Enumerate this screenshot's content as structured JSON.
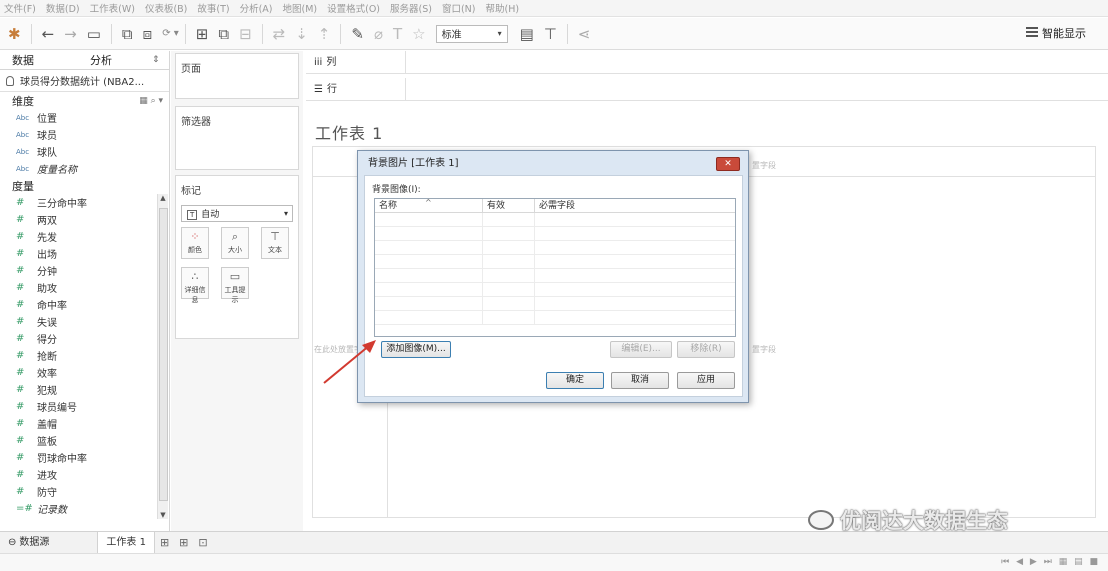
{
  "menu": [
    "文件(F)",
    "数据(D)",
    "工作表(W)",
    "仪表板(B)",
    "故事(T)",
    "分析(A)",
    "地图(M)",
    "设置格式(O)",
    "服务器(S)",
    "窗口(N)",
    "帮助(H)"
  ],
  "toolbar": {
    "fit_select": "标准",
    "smart_show": "智能显示"
  },
  "left_tabs": {
    "data": "数据",
    "analysis": "分析"
  },
  "datasource_name": "球员得分数据统计 (NBA2...",
  "dimensions": {
    "header": "维度",
    "items": [
      {
        "type": "Abc",
        "label": "位置"
      },
      {
        "type": "Abc",
        "label": "球员"
      },
      {
        "type": "Abc",
        "label": "球队"
      },
      {
        "type": "Abc",
        "label": "度量名称"
      }
    ]
  },
  "measures": {
    "header": "度量",
    "items": [
      "三分命中率",
      "两双",
      "先发",
      "出场",
      "分钟",
      "助攻",
      "命中率",
      "失误",
      "得分",
      "抢断",
      "效率",
      "犯规",
      "球员编号",
      "盖帽",
      "篮板",
      "罚球命中率",
      "进攻",
      "防守",
      "记录数"
    ]
  },
  "shelves": {
    "pages": "页面",
    "filters": "筛选器",
    "marks": "标记",
    "columns": "列",
    "rows": "行"
  },
  "marks": {
    "type": "自动",
    "buttons": [
      "颜色",
      "大小",
      "文本",
      "详细信息",
      "工具提示"
    ]
  },
  "sheet_title": "工作表 1",
  "canvas_hints": {
    "drop_field": "在此处放置字段",
    "drop_right": "置字段"
  },
  "dialog": {
    "title": "背景图片 [工作表 1]",
    "caption": "背景图像(I):",
    "columns": [
      "名称",
      "有效",
      "必需字段"
    ],
    "buttons": {
      "add": "添加图像(M)...",
      "edit": "编辑(E)...",
      "remove": "移除(R)",
      "ok": "确定",
      "cancel": "取消",
      "apply": "应用"
    }
  },
  "bottom": {
    "datasource_tab": "数据源",
    "sheet_tab": "工作表 1"
  },
  "watermark": "优阅达大数据生态",
  "colors": {
    "arrow": "#d23a30",
    "dialog_bg": "#dce7f3",
    "close_button": "#c94a3a"
  }
}
